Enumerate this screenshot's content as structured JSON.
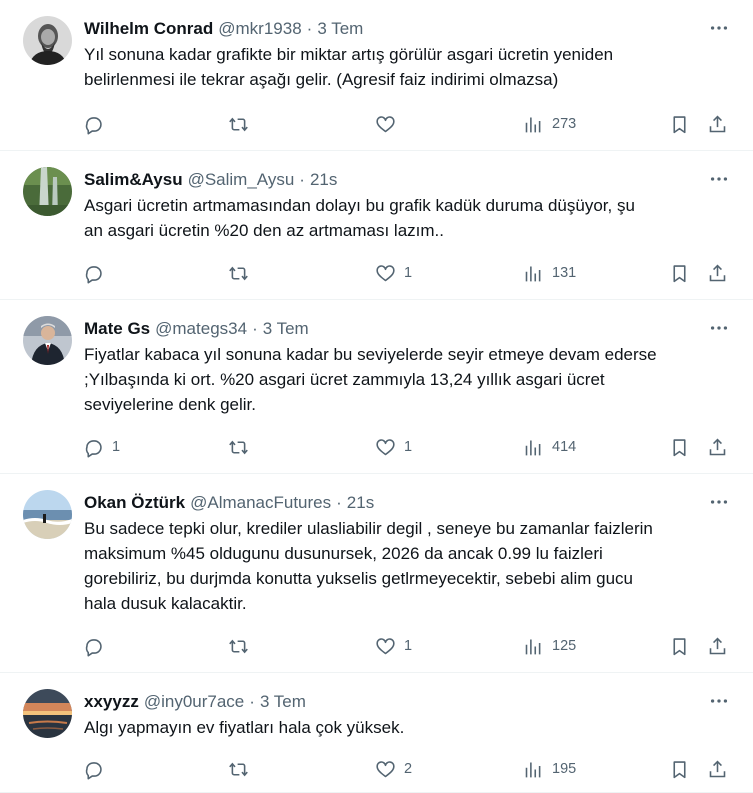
{
  "tweets": [
    {
      "name": "Wilhelm Conrad",
      "handle": "@mkr1938",
      "time": "3 Tem",
      "text": "Yıl sonuna kadar grafikte bir miktar artış görülür asgari ücretin yeniden\nbelirlenmesi ile tekrar aşağı gelir. (Agresif faiz indirimi olmazsa)",
      "replies": "",
      "retweets": "",
      "likes": "",
      "views": "273",
      "avatar": "portrait-bw"
    },
    {
      "name": "Salim&Aysu",
      "handle": "@Salim_Aysu",
      "time": "21s",
      "text": "Asgari ücretin artmamasından dolayı bu grafik kadük duruma düşüyor, şu\nan asgari ücretin %20 den az artmaması lazım..",
      "replies": "",
      "retweets": "",
      "likes": "1",
      "views": "131",
      "avatar": "waterfall"
    },
    {
      "name": "Mate Gs",
      "handle": "@mategs34",
      "time": "3 Tem",
      "text": "Fiyatlar kabaca yıl sonuna kadar bu seviyelerde seyir etmeye devam ederse\n;Yılbaşında ki ort. %20 asgari ücret zammıyla 13,24 yıllık asgari ücret\nseviyelerine denk gelir.",
      "replies": "1",
      "retweets": "",
      "likes": "1",
      "views": "414",
      "avatar": "man-suit"
    },
    {
      "name": "Okan Öztürk",
      "handle": "@AlmanacFutures",
      "time": "21s",
      "text": "Bu sadece tepki olur, krediler ulasliabilir degil , seneye bu zamanlar faizlerin\nmaksimum %45 oldugunu dusunursek, 2026 da ancak 0.99 lu faizleri\ngorebiliriz, bu durjmda konutta yukselis getlrmeyecektir, sebebi alim gucu\nhala dusuk kalacaktir.",
      "replies": "",
      "retweets": "",
      "likes": "1",
      "views": "125",
      "avatar": "beach"
    },
    {
      "name": "xxyyzz",
      "handle": "@iny0ur7ace",
      "time": "3 Tem",
      "text": "Algı yapmayın ev fiyatları hala çok yüksek.",
      "replies": "",
      "retweets": "",
      "likes": "2",
      "views": "195",
      "avatar": "sunset-sea"
    }
  ],
  "separator": "·",
  "icons": {
    "reply": "reply-icon",
    "retweet": "retweet-icon",
    "like": "heart-icon",
    "views": "views-icon",
    "bookmark": "bookmark-icon",
    "share": "share-icon",
    "more": "more-icon"
  }
}
